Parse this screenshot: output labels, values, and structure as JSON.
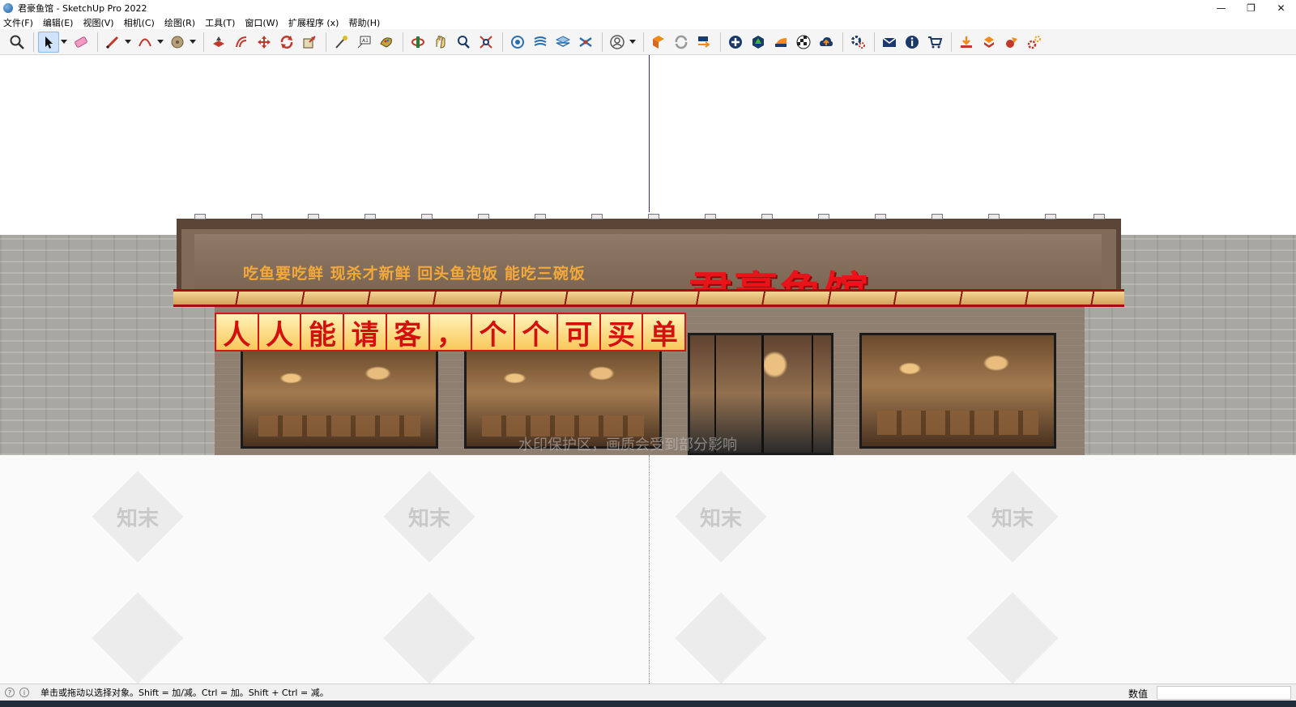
{
  "window": {
    "title": "君豪鱼馆 - SketchUp Pro 2022",
    "controls": {
      "minimize": "—",
      "restore": "❐",
      "close": "✕"
    }
  },
  "menu": [
    "文件(F)",
    "编辑(E)",
    "视图(V)",
    "相机(C)",
    "绘图(R)",
    "工具(T)",
    "窗口(W)",
    "扩展程序 (x)",
    "帮助(H)"
  ],
  "toolbar": {
    "groups": [
      [
        "zoom-icon"
      ],
      [
        "select-icon",
        "eraser-icon",
        "pencil-icon",
        "arc-icon",
        "paint-bucket-icon"
      ],
      [
        "push-pull-icon",
        "offset-icon",
        "move-icon",
        "rotate-icon",
        "scale-icon"
      ],
      [
        "tape-measure-icon",
        "text-icon",
        "paint-icon"
      ],
      [
        "orbit-icon",
        "pan-icon",
        "zoom-window-icon",
        "zoom-extents-icon"
      ],
      [
        "warehouse-icon",
        "components-icon",
        "layers-icon",
        "extension-icon"
      ],
      [
        "user-icon"
      ],
      [
        "sync-icon",
        "refresh-icon",
        "export-icon"
      ],
      [
        "add-icon",
        "tree-icon",
        "layout-icon",
        "checker-icon",
        "upload-icon"
      ],
      [
        "settings-icon"
      ],
      [
        "mail-icon",
        "info-icon",
        "cart-icon"
      ],
      [
        "plugin-a-icon",
        "plugin-b-icon",
        "plugin-c-icon",
        "plugin-d-icon"
      ]
    ]
  },
  "scene": {
    "slogan": "吃鱼要吃鲜 现杀才新鲜 回头鱼泡饭 能吃三碗饭",
    "brand": "君豪鱼馆",
    "banner_chars": [
      "人",
      "人",
      "能",
      "请",
      "客",
      "，",
      "个",
      "个",
      "可",
      "买",
      "单"
    ],
    "watermark_text": "水印保护区，画质会受到部分影响",
    "tile_watermark": "知末"
  },
  "status": {
    "hint": "单击或拖动以选择对象。Shift = 加/减。Ctrl = 加。Shift + Ctrl = 减。",
    "measure_label": "数值",
    "measure_value": ""
  },
  "colors": {
    "brand_red": "#e8141a",
    "slogan_orange": "#f4a83a",
    "accent_blue": "#1d5fa3"
  }
}
